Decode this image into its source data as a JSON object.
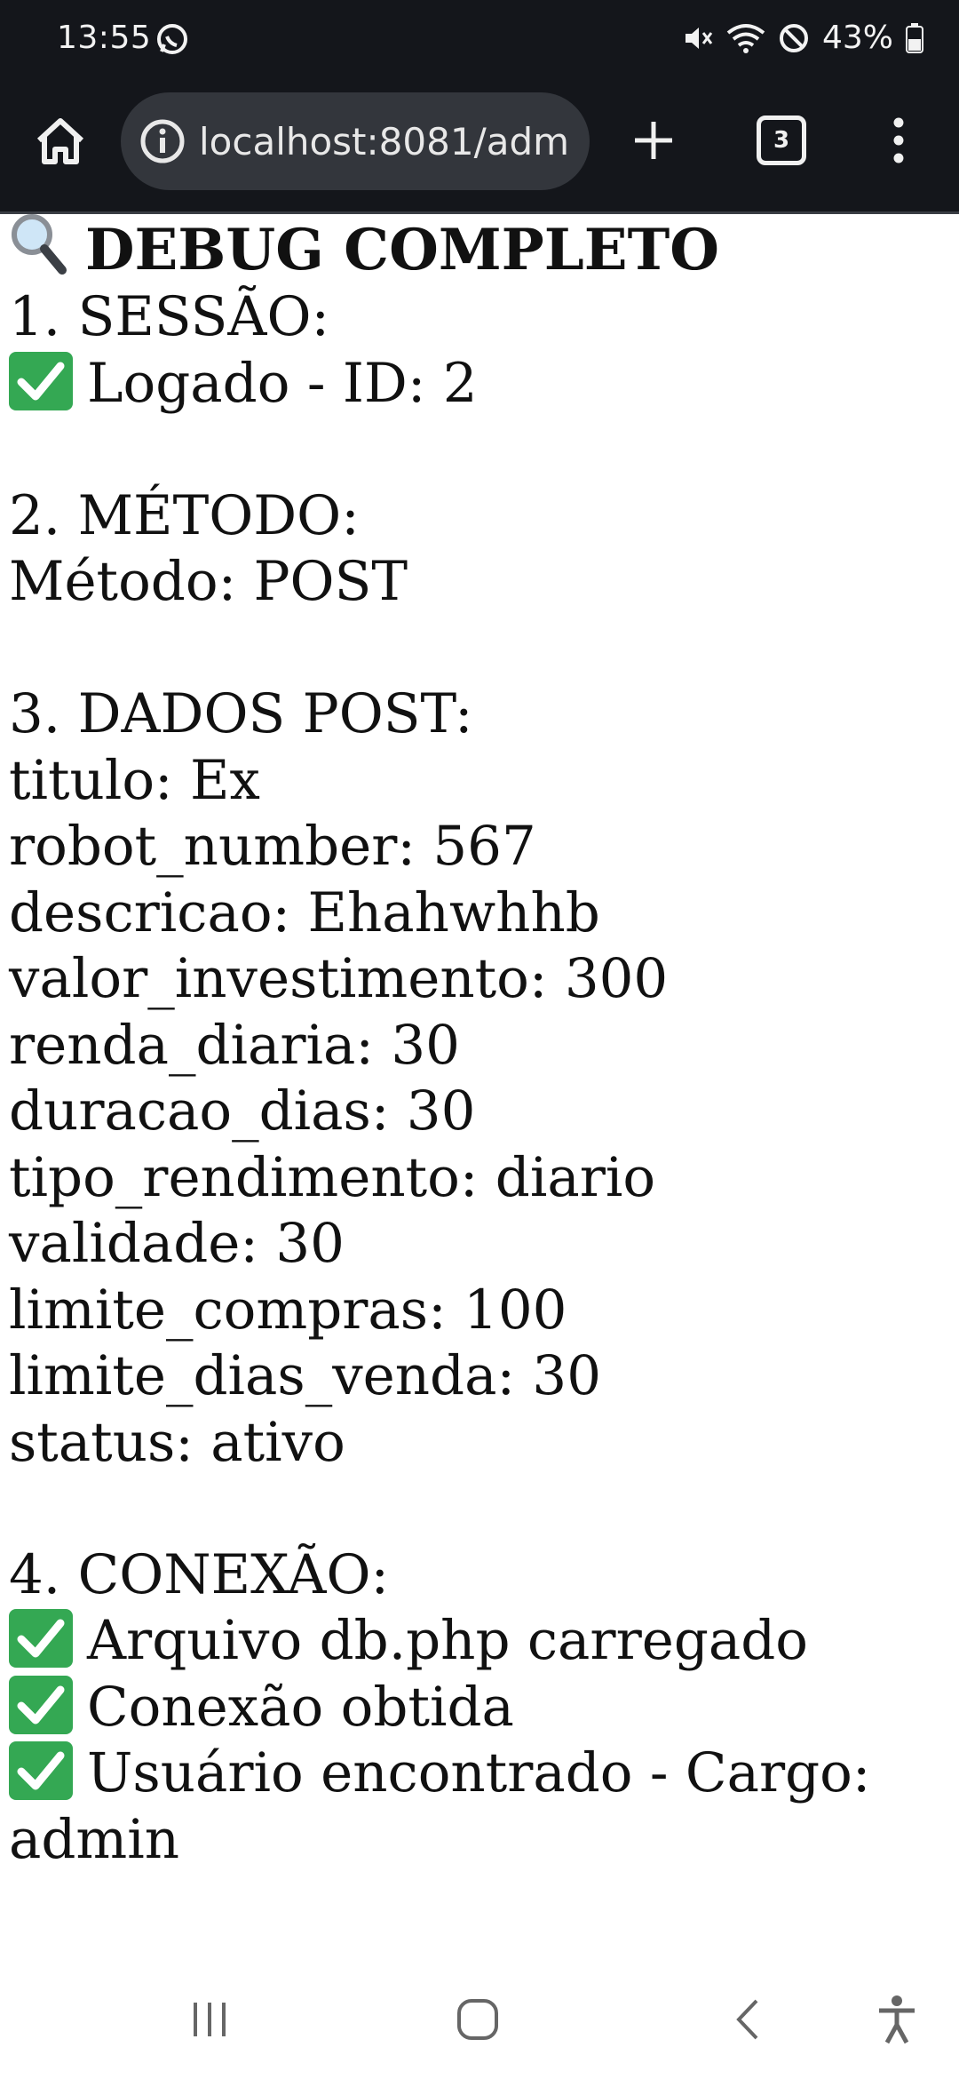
{
  "status_bar": {
    "time": "13:55",
    "battery": "43%"
  },
  "browser": {
    "url": "localhost:8081/adm",
    "tab_count": "3"
  },
  "page": {
    "title": "DEBUG COMPLETO",
    "section1": {
      "heading": "1. SESSÃO:",
      "status": "Logado - ID: 2"
    },
    "section2": {
      "heading": "2. MÉTODO:",
      "method": "Método: POST"
    },
    "section3": {
      "heading": "3. DADOS POST:",
      "fields": [
        "titulo: Ex",
        "robot_number: 567",
        "descricao: Ehahwhhb",
        "valor_investimento: 300",
        "renda_diaria: 30",
        "duracao_dias: 30",
        "tipo_rendimento: diario",
        "validade: 30",
        "limite_compras: 100",
        "limite_dias_venda: 30",
        "status: ativo"
      ]
    },
    "section4": {
      "heading": "4. CONEXÃO:",
      "items": [
        "Arquivo db.php carregado",
        "Conexão obtida",
        "Usuário encontrado - Cargo:"
      ],
      "continuation": "admin"
    }
  },
  "icons": {
    "home": "home-icon",
    "info": "info-icon",
    "new_tab": "plus-icon",
    "tabs": "tabs-icon",
    "menu": "more-vert-icon",
    "check": "check-mark-icon",
    "magnifier": "magnifier-icon"
  },
  "colors": {
    "status_bg": "#14161b",
    "url_bar_bg": "#33363c",
    "check_green": "#34a853"
  }
}
